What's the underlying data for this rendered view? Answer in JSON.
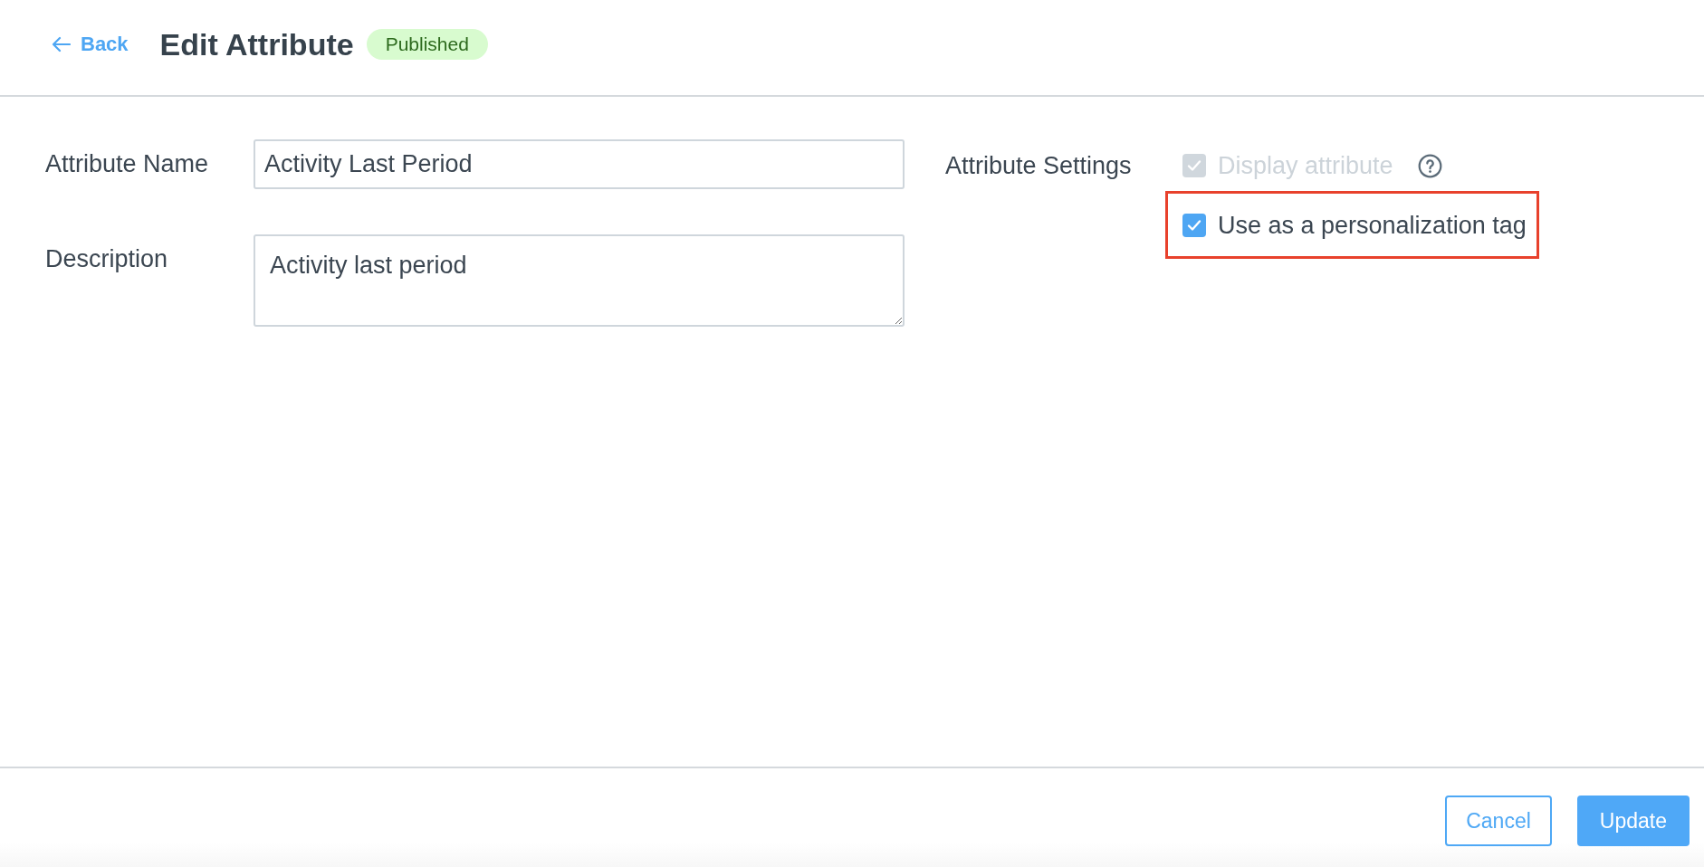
{
  "header": {
    "back_link": "Back",
    "title": "Edit Attribute",
    "status": "Published"
  },
  "fields": [
    {
      "kind": "input",
      "label": "Attribute Name",
      "value": "Activity Last Period"
    },
    {
      "kind": "textarea",
      "label": "Description",
      "value": "Activity last period"
    }
  ],
  "settings": {
    "label": "Attribute Settings",
    "options": [
      {
        "label": "Display attribute",
        "checked": true,
        "disabled": true,
        "help": true,
        "highlighted": false
      },
      {
        "label": "Use as a personalization tag",
        "checked": true,
        "disabled": false,
        "help": false,
        "highlighted": true
      }
    ]
  },
  "footer": {
    "buttons": [
      {
        "kind": "outline",
        "label": "Cancel"
      },
      {
        "kind": "primary",
        "label": "Update"
      }
    ]
  }
}
